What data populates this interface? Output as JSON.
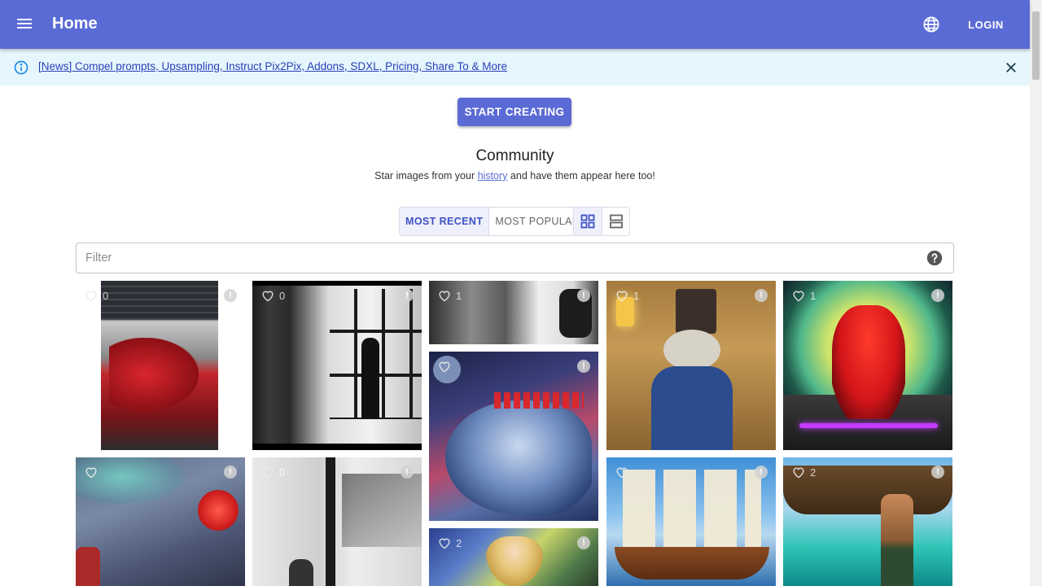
{
  "appbar": {
    "title": "Home",
    "login_label": "LOGIN",
    "color": "#5a6bd6"
  },
  "news": {
    "text": "[News] Compel prompts, Upsampling, Instruct Pix2Pix, Addons, SDXL, Pricing, Share To & More"
  },
  "cta": {
    "start_label": "START CREATING"
  },
  "community": {
    "title": "Community",
    "subtitle_before": "Star images from your ",
    "subtitle_link": "history",
    "subtitle_after": " and have them appear here too!"
  },
  "sort_tabs": {
    "recent": "MOST RECENT",
    "popular": "MOST POPULAR",
    "selected": "MOST RECENT"
  },
  "view_modes": {
    "grid_icon": "grid-view-icon",
    "list_icon": "list-view-icon",
    "selected": "grid"
  },
  "filter": {
    "placeholder": "Filter",
    "value": ""
  },
  "gallery": [
    {
      "subject": "red machine part with software screenshot",
      "likes": "0"
    },
    {
      "subject": "silhouette walking by window",
      "likes": "0"
    },
    {
      "subject": "man with earphones black and white",
      "likes": "1"
    },
    {
      "subject": "blue and red dragon under moon",
      "likes": ""
    },
    {
      "subject": "ferret in top hat with lantern",
      "likes": "1"
    },
    {
      "subject": "red dragon before glowing moon",
      "likes": "1"
    },
    {
      "subject": "blossom tree with red moon",
      "likes": ""
    },
    {
      "subject": "shadow on wall grayscale",
      "likes": "0"
    },
    {
      "subject": "anime girl with blonde hair",
      "likes": "2"
    },
    {
      "subject": "tall ship with white sails",
      "likes": ""
    },
    {
      "subject": "man before pirate ship on beach",
      "likes": "2"
    }
  ]
}
